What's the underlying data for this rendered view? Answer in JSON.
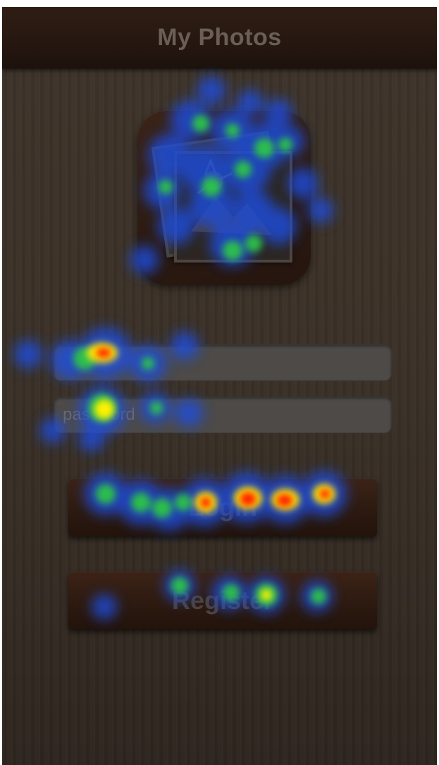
{
  "navbar": {
    "title": "My Photos"
  },
  "login_form": {
    "username_placeholder": "",
    "password_placeholder": "password"
  },
  "buttons": {
    "login_label": "Login",
    "register_label": "Register"
  },
  "icons": {
    "app_logo": "photos-app-icon"
  },
  "colors": {
    "navbar": "#261811",
    "background": "#3a3027",
    "button": "#2d1a10",
    "field": "#4d4a48"
  }
}
